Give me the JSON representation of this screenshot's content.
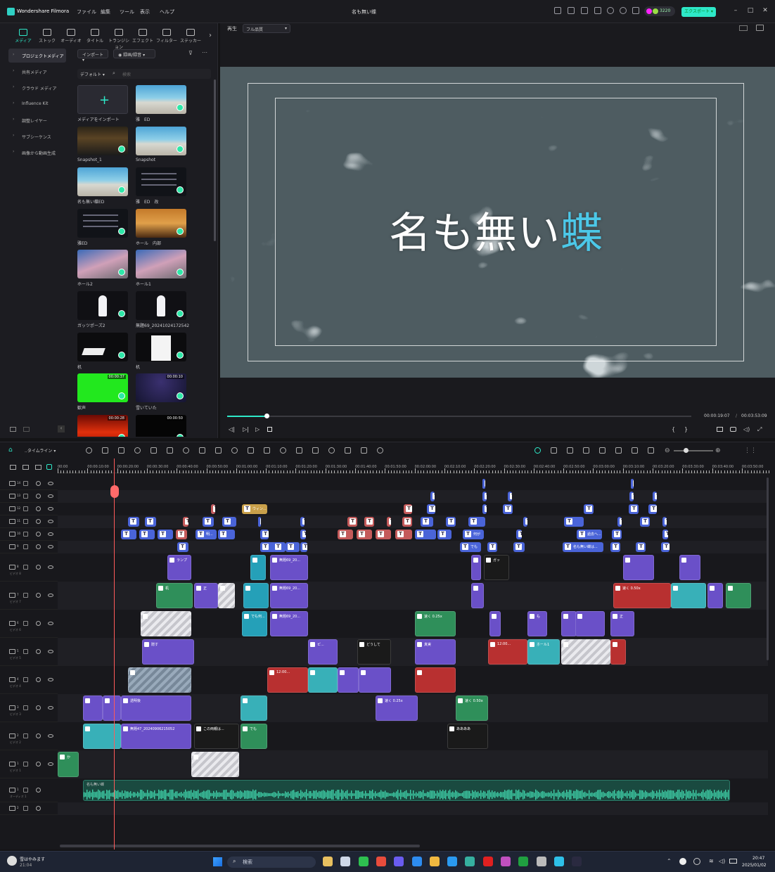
{
  "app": {
    "name": "Wondershare Filmora",
    "project_title": "名も無い蝶",
    "menu": [
      "ファイル",
      "編集",
      "ツール",
      "表示",
      "ヘルプ"
    ],
    "credits": "3220",
    "export_label": "エクスポート"
  },
  "toolbar_tabs": [
    "メディア",
    "ストック",
    "オーディオ",
    "タイトル",
    "トランジション",
    "エフェクト",
    "フィルター",
    "ステッカー"
  ],
  "side_nav": [
    "プロジェクトメディア",
    "共有メディア",
    "クラウド メディア",
    "Influence Kit",
    "調整レイヤー",
    "サブシーケンス",
    "画像から動画生成"
  ],
  "media_toolbar": {
    "import_label": "インポート",
    "record_label": "録画/録音",
    "sort_label": "デフォルト",
    "search_placeholder": "検索"
  },
  "media_items": [
    {
      "caption": "メディアをインポート",
      "kind": "import",
      "duration": ""
    },
    {
      "caption": "雅　ED",
      "kind": "beach",
      "duration": ""
    },
    {
      "caption": "Snapshot_1",
      "kind": "stage",
      "duration": ""
    },
    {
      "caption": "Snapshot",
      "kind": "beach",
      "duration": ""
    },
    {
      "caption": "名も無い蝶ED",
      "kind": "beach",
      "duration": ""
    },
    {
      "caption": "雅　ED　改",
      "kind": "dark",
      "duration": ""
    },
    {
      "caption": "雅ED",
      "kind": "dark",
      "duration": ""
    },
    {
      "caption": "ホール　内部",
      "kind": "hall",
      "duration": ""
    },
    {
      "caption": "ホール2",
      "kind": "sky",
      "duration": ""
    },
    {
      "caption": "ホール1",
      "kind": "sky",
      "duration": ""
    },
    {
      "caption": "ガッツポーズ2",
      "kind": "figure",
      "duration": ""
    },
    {
      "caption": "無題69_20241024172542",
      "kind": "figure",
      "duration": ""
    },
    {
      "caption": "机",
      "kind": "desk",
      "duration": ""
    },
    {
      "caption": "机",
      "kind": "desk2",
      "duration": ""
    },
    {
      "caption": "歓声",
      "kind": "green",
      "duration": "00:00:37"
    },
    {
      "caption": "雪いていた",
      "kind": "night",
      "duration": "00:00:10"
    },
    {
      "caption": "",
      "kind": "fire",
      "duration": "00:00:28"
    },
    {
      "caption": "",
      "kind": "black",
      "duration": "00:00:50"
    }
  ],
  "preview": {
    "play_label": "再生",
    "quality": "フル品質",
    "title_main": "名も無い",
    "title_accent": "蝶",
    "current_time": "00:00:19:07",
    "total_time": "00:03:53:09",
    "progress": 0.085
  },
  "timeline": {
    "label": "タイムライン",
    "ruler": [
      "00:00",
      "00:00:10:00",
      "00:00:20:00",
      "00:00:30:00",
      "00:00:40:00",
      "00:00:50:00",
      "00:01:00:00",
      "00:01:10:00",
      "00:01:20:00",
      "00:01:30:00",
      "00:01:40:00",
      "00:01:50:00",
      "00:02:00:00",
      "00:02:10:00",
      "00:02:20:00",
      "00:02:30:00",
      "00:02:40:00",
      "00:02:50:00",
      "00:03:00:00",
      "00:03:10:00",
      "00:03:20:00",
      "00:03:30:00",
      "00:03:40:00",
      "00:03:50:00"
    ],
    "tracks": [
      {
        "num": "14",
        "type": "title"
      },
      {
        "num": "13",
        "type": "title"
      },
      {
        "num": "12",
        "type": "title"
      },
      {
        "num": "11",
        "type": "title"
      },
      {
        "num": "10",
        "type": "title"
      },
      {
        "num": "9",
        "type": "title"
      },
      {
        "num": "8",
        "type": "video",
        "label": "ビデオ 8"
      },
      {
        "num": "7",
        "type": "video",
        "label": "ビデオ 7"
      },
      {
        "num": "6",
        "type": "video",
        "label": "ビデオ 6"
      },
      {
        "num": "5",
        "type": "video",
        "label": "ビデオ 5"
      },
      {
        "num": "4",
        "type": "video",
        "label": "ビデオ 4"
      },
      {
        "num": "3",
        "type": "video",
        "label": "ビデオ 3"
      },
      {
        "num": "2",
        "type": "video",
        "label": "ビデオ 2"
      },
      {
        "num": "1",
        "type": "video",
        "label": "ビデオ 1"
      },
      {
        "num": "1",
        "type": "audio",
        "label": "オーディオ 1"
      },
      {
        "num": "2",
        "type": "audio",
        "label": ""
      }
    ],
    "clip_labels": {
      "title_win": "ウィン...",
      "t_mei": "明...",
      "t_nanige": "何が",
      "t_demo": "でも",
      "t_nanashi": "名も無い蝶は...",
      "t_kako": "過去へ...",
      "t_kono": "この",
      "v_ran": "ランプ",
      "v_mudai": "無題69_20...",
      "v_gatsu": "ガッ",
      "v_tsukue": "机",
      "v_sei": "正",
      "v_kakushi": "隠す",
      "v_speed1": "速く 0.25x",
      "v_fuun": "歓声",
      "v_speed2": "速く 0.50x",
      "v_mo": "も",
      "v_shinjitsu": "真実",
      "v_pi": "ピ...",
      "v_doushite": "どうして",
      "v_hall": "ホール1",
      "v_fire": "12:00...",
      "v_kotou": "透明後",
      "v_yuki": "雪いていた",
      "v_demona": "でも何...",
      "v_mudai47": "無題47_20240906215052",
      "v_kono": "この両親は...",
      "v_demo2": "でも",
      "v_aaa": "ああああ",
      "v_ka": "か",
      "audio_name": "名も無い蝶"
    }
  },
  "taskbar": {
    "weather": "雪はやみます",
    "weather_time": "21:04",
    "search": "検索",
    "time": "20:47",
    "date": "2025/01/02"
  }
}
